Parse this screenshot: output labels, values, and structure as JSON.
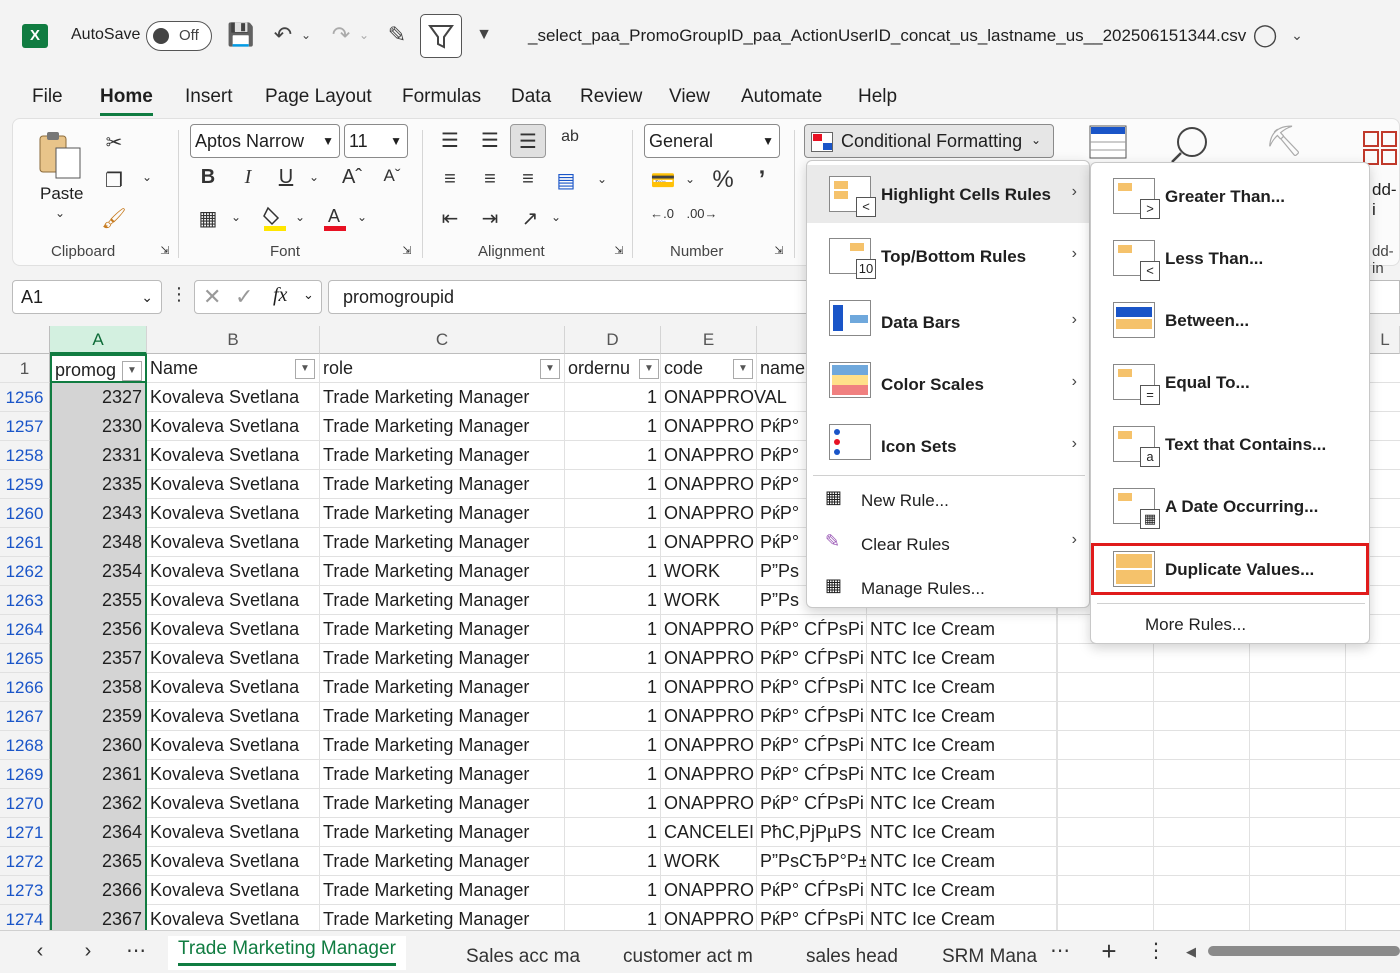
{
  "titlebar": {
    "autosave_label": "AutoSave",
    "autosave_state": "Off",
    "doc_title": "_select_paa_PromoGroupID_paa_ActionUserID_concat_us_lastname_us__202506151344.csv"
  },
  "menu_tabs": [
    "File",
    "Home",
    "Insert",
    "Page Layout",
    "Formulas",
    "Data",
    "Review",
    "View",
    "Automate",
    "Help"
  ],
  "ribbon": {
    "paste_label": "Paste",
    "font_name": "Aptos Narrow",
    "font_size": "11",
    "number_format": "General",
    "cond_format_label": "Conditional Formatting",
    "groups": [
      "Clipboard",
      "Font",
      "Alignment",
      "Number"
    ],
    "addin_partial": "dd-i",
    "addin_partial2": "dd-in"
  },
  "formula_bar": {
    "cell_ref": "A1",
    "fx": "fx",
    "value": "promogroupid"
  },
  "columns": [
    "A",
    "B",
    "C",
    "D",
    "E",
    "L"
  ],
  "header_row": {
    "num": "1",
    "a": "promog",
    "b": "Name",
    "c": "role",
    "d": "ordernu",
    "e": "code",
    "f": "name"
  },
  "rows": [
    {
      "num": "1256",
      "a": "2327",
      "b": "Kovaleva Svetlana",
      "c": "Trade Marketing Manager",
      "d": "1",
      "e": "ONAPPROVAL",
      "f": "",
      "g": ""
    },
    {
      "num": "1257",
      "a": "2330",
      "b": "Kovaleva Svetlana",
      "c": "Trade Marketing Manager",
      "d": "1",
      "e": "ONAPPRO",
      "f": "РќР°",
      "g": ""
    },
    {
      "num": "1258",
      "a": "2331",
      "b": "Kovaleva Svetlana",
      "c": "Trade Marketing Manager",
      "d": "1",
      "e": "ONAPPRO",
      "f": "РќР°",
      "g": ""
    },
    {
      "num": "1259",
      "a": "2335",
      "b": "Kovaleva Svetlana",
      "c": "Trade Marketing Manager",
      "d": "1",
      "e": "ONAPPRO",
      "f": "РќР°",
      "g": ""
    },
    {
      "num": "1260",
      "a": "2343",
      "b": "Kovaleva Svetlana",
      "c": "Trade Marketing Manager",
      "d": "1",
      "e": "ONAPPRO",
      "f": "РќР°",
      "g": ""
    },
    {
      "num": "1261",
      "a": "2348",
      "b": "Kovaleva Svetlana",
      "c": "Trade Marketing Manager",
      "d": "1",
      "e": "ONAPPRO",
      "f": "РќР°",
      "g": ""
    },
    {
      "num": "1262",
      "a": "2354",
      "b": "Kovaleva Svetlana",
      "c": "Trade Marketing Manager",
      "d": "1",
      "e": "WORK",
      "f": "Р”Рs",
      "g": ""
    },
    {
      "num": "1263",
      "a": "2355",
      "b": "Kovaleva Svetlana",
      "c": "Trade Marketing Manager",
      "d": "1",
      "e": "WORK",
      "f": "Р”Рs",
      "g": ""
    },
    {
      "num": "1264",
      "a": "2356",
      "b": "Kovaleva Svetlana",
      "c": "Trade Marketing Manager",
      "d": "1",
      "e": "ONAPPRO",
      "f": "РќР° СЃРѕРі",
      "g": "NTC Ice Cream"
    },
    {
      "num": "1265",
      "a": "2357",
      "b": "Kovaleva Svetlana",
      "c": "Trade Marketing Manager",
      "d": "1",
      "e": "ONAPPRO",
      "f": "РќР° СЃРѕРі",
      "g": "NTC Ice Cream"
    },
    {
      "num": "1266",
      "a": "2358",
      "b": "Kovaleva Svetlana",
      "c": "Trade Marketing Manager",
      "d": "1",
      "e": "ONAPPRO",
      "f": "РќР° СЃРѕРі",
      "g": "NTC Ice Cream"
    },
    {
      "num": "1267",
      "a": "2359",
      "b": "Kovaleva Svetlana",
      "c": "Trade Marketing Manager",
      "d": "1",
      "e": "ONAPPRO",
      "f": "РќР° СЃРѕРі",
      "g": "NTC Ice Cream"
    },
    {
      "num": "1268",
      "a": "2360",
      "b": "Kovaleva Svetlana",
      "c": "Trade Marketing Manager",
      "d": "1",
      "e": "ONAPPRO",
      "f": "РќР° СЃРѕРі",
      "g": "NTC Ice Cream"
    },
    {
      "num": "1269",
      "a": "2361",
      "b": "Kovaleva Svetlana",
      "c": "Trade Marketing Manager",
      "d": "1",
      "e": "ONAPPRO",
      "f": "РќР° СЃРѕРі",
      "g": "NTC Ice Cream"
    },
    {
      "num": "1270",
      "a": "2362",
      "b": "Kovaleva Svetlana",
      "c": "Trade Marketing Manager",
      "d": "1",
      "e": "ONAPPRO",
      "f": "РќР° СЃРѕРі",
      "g": "NTC Ice Cream"
    },
    {
      "num": "1271",
      "a": "2364",
      "b": "Kovaleva Svetlana",
      "c": "Trade Marketing Manager",
      "d": "1",
      "e": "CANCELEI",
      "f": "РћС‚РјРµРЅ",
      "g": "NTC Ice Cream"
    },
    {
      "num": "1272",
      "a": "2365",
      "b": "Kovaleva Svetlana",
      "c": "Trade Marketing Manager",
      "d": "1",
      "e": "WORK",
      "f": "Р”РѕСЂР°Р±",
      "g": "NTC Ice Cream"
    },
    {
      "num": "1273",
      "a": "2366",
      "b": "Kovaleva Svetlana",
      "c": "Trade Marketing Manager",
      "d": "1",
      "e": "ONAPPRO",
      "f": "РќР° СЃРѕРі",
      "g": "NTC Ice Cream"
    },
    {
      "num": "1274",
      "a": "2367",
      "b": "Kovaleva Svetlana",
      "c": "Trade Marketing Manager",
      "d": "1",
      "e": "ONAPPRO",
      "f": "РќР° СЃРѕРі",
      "g": "NTC Ice Cream"
    }
  ],
  "cf_menu": {
    "items": [
      "Highlight Cells Rules",
      "Top/Bottom Rules",
      "Data Bars",
      "Color Scales",
      "Icon Sets"
    ],
    "plain_items": [
      "New Rule...",
      "Clear Rules",
      "Manage Rules..."
    ]
  },
  "hcr_menu": {
    "items": [
      "Greater Than...",
      "Less Than...",
      "Between...",
      "Equal To...",
      "Text that Contains...",
      "A Date Occurring...",
      "Duplicate Values..."
    ],
    "more": "More Rules..."
  },
  "sheet_tabs": [
    "Trade Marketing Manager",
    "Sales acc ma",
    "customer act m",
    "sales head",
    "SRM Mana"
  ],
  "colors": {
    "excel_green": "#107c41",
    "highlight_red": "#e01b1b",
    "selection_gray": "#d4d4d4"
  }
}
